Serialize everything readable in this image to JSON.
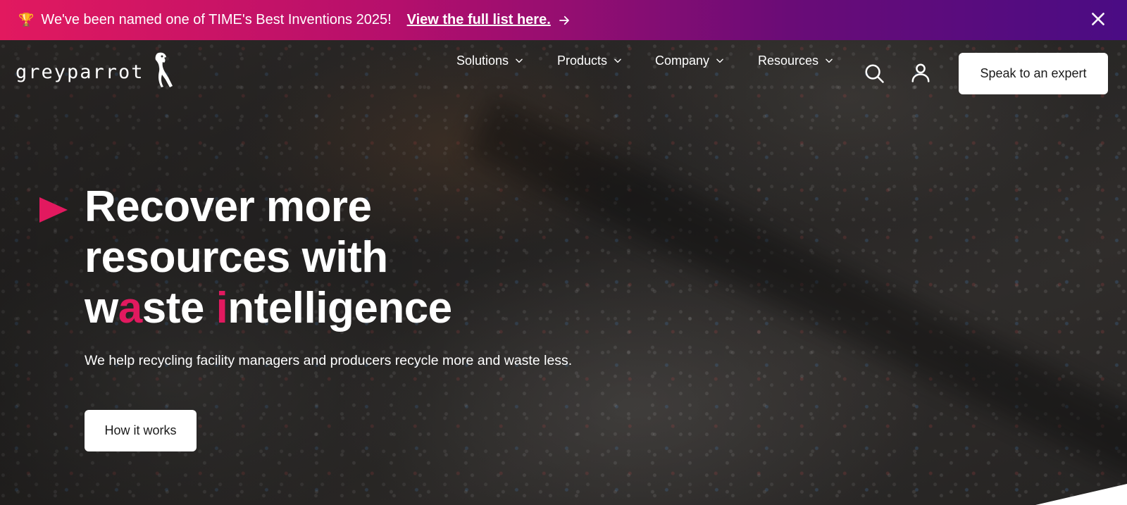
{
  "banner": {
    "trophy_icon": "trophy-icon",
    "text": "We've been named one of TIME's Best Inventions 2025!",
    "link_label": "View the full list here.",
    "arrow_icon": "arrow-right-icon",
    "close_icon": "close-icon"
  },
  "brand": {
    "logo_text": "greyparrot",
    "logo_icon": "parrot-icon"
  },
  "nav": {
    "items": [
      {
        "label": "Solutions",
        "icon": "chevron-down-icon"
      },
      {
        "label": "Products",
        "icon": "chevron-down-icon"
      },
      {
        "label": "Company",
        "icon": "chevron-down-icon"
      },
      {
        "label": "Resources",
        "icon": "chevron-down-icon"
      }
    ],
    "search_icon": "search-icon",
    "account_icon": "user-icon",
    "cta_label": "Speak to an expert"
  },
  "hero": {
    "headline_line1": "Recover more",
    "headline_line2": "resources with",
    "headline_line3": {
      "w": "w",
      "a": "a",
      "ste": "ste ",
      "i": "i",
      "ntelligence": "ntelligence"
    },
    "subtext": "We help recycling facility managers and producers recycle more and waste less.",
    "cta_label": "How it works"
  },
  "colors": {
    "accent": "#e2195f",
    "banner_gradient_start": "#e2195f",
    "banner_gradient_end": "#4a0c84",
    "button_bg": "#ffffff",
    "button_text": "#1b1b1b"
  }
}
